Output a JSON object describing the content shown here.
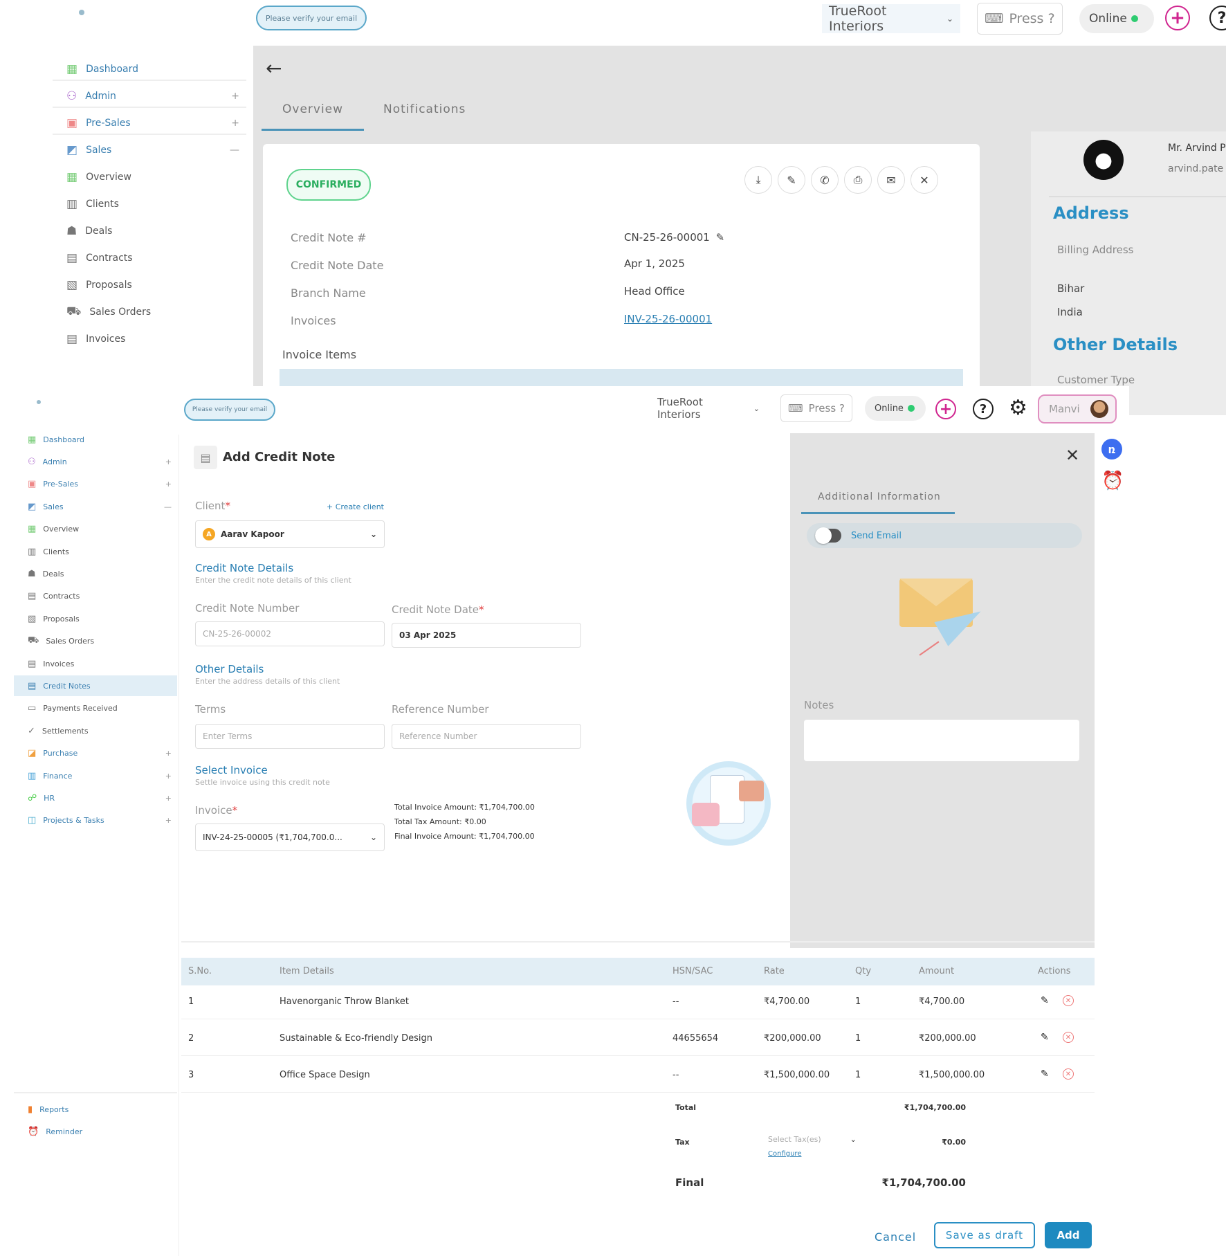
{
  "colors": {
    "accent_blue": "#2a8fc4",
    "brand_pink": "#d0248f",
    "confirmed_green": "#2aae5f",
    "online_green": "#2ecc71",
    "add_button": "#1e8ac0"
  },
  "separator": "&",
  "back_screen": {
    "header": {
      "verify_email": "Please verify your email",
      "company": "TrueRoot Interiors",
      "press_hint": "Press ?",
      "status": "Online"
    },
    "sidebar": [
      {
        "label": "Dashboard",
        "icon": "grid-icon",
        "toggle": ""
      },
      {
        "label": "Admin",
        "icon": "user-admin-icon",
        "toggle": "+"
      },
      {
        "label": "Pre-Sales",
        "icon": "calendar-icon",
        "toggle": "+"
      },
      {
        "label": "Sales",
        "icon": "sales-icon",
        "toggle": "—"
      },
      {
        "label": "Overview",
        "icon": "grid-icon",
        "toggle": ""
      },
      {
        "label": "Clients",
        "icon": "building-icon",
        "toggle": ""
      },
      {
        "label": "Deals",
        "icon": "deal-icon",
        "toggle": ""
      },
      {
        "label": "Contracts",
        "icon": "document-icon",
        "toggle": ""
      },
      {
        "label": "Proposals",
        "icon": "proposal-icon",
        "toggle": ""
      },
      {
        "label": "Sales Orders",
        "icon": "cart-icon",
        "toggle": ""
      },
      {
        "label": "Invoices",
        "icon": "invoice-icon",
        "toggle": ""
      }
    ],
    "tabs": [
      "Overview",
      "Notifications"
    ],
    "status_badge": "CONFIRMED",
    "details": [
      {
        "label": "Credit Note #",
        "value": "CN-25-26-00001"
      },
      {
        "label": "Credit Note Date",
        "value": "Apr 1, 2025"
      },
      {
        "label": "Branch Name",
        "value": "Head Office"
      },
      {
        "label": "Invoices",
        "value": "INV-25-26-00001"
      }
    ],
    "invoice_items_label": "Invoice Items",
    "right_panel": {
      "name": "Mr. Arvind P",
      "email": "arvind.pate",
      "address_heading": "Address",
      "billing_address_label": "Billing Address",
      "address_line1": "Bihar",
      "address_line2": "India",
      "other_details_heading": "Other Details",
      "customer_type_label": "Customer Type"
    }
  },
  "front_screen": {
    "header": {
      "verify_email": "Please verify your email",
      "company": "TrueRoot Interiors",
      "press_hint": "Press ?",
      "status": "Online",
      "user_name": "Manvi"
    },
    "sidebar": [
      {
        "label": "Dashboard",
        "icon": "grid-icon",
        "toggle": ""
      },
      {
        "label": "Admin",
        "icon": "user-admin-icon",
        "toggle": "+"
      },
      {
        "label": "Pre-Sales",
        "icon": "calendar-icon",
        "toggle": "+"
      },
      {
        "label": "Sales",
        "icon": "sales-icon",
        "toggle": "—"
      },
      {
        "label": "Overview",
        "icon": "grid-icon",
        "toggle": ""
      },
      {
        "label": "Clients",
        "icon": "building-icon",
        "toggle": ""
      },
      {
        "label": "Deals",
        "icon": "deal-icon",
        "toggle": ""
      },
      {
        "label": "Contracts",
        "icon": "document-icon",
        "toggle": ""
      },
      {
        "label": "Proposals",
        "icon": "proposal-icon",
        "toggle": ""
      },
      {
        "label": "Sales Orders",
        "icon": "cart-icon",
        "toggle": ""
      },
      {
        "label": "Invoices",
        "icon": "invoice-icon",
        "toggle": ""
      },
      {
        "label": "Credit Notes",
        "icon": "credit-note-icon",
        "toggle": ""
      },
      {
        "label": "Payments Received",
        "icon": "payment-icon",
        "toggle": ""
      },
      {
        "label": "Settlements",
        "icon": "check-icon",
        "toggle": ""
      },
      {
        "label": "Purchase",
        "icon": "purchase-icon",
        "toggle": "+"
      },
      {
        "label": "Finance",
        "icon": "finance-icon",
        "toggle": "+"
      },
      {
        "label": "HR",
        "icon": "hr-icon",
        "toggle": "+"
      },
      {
        "label": "Projects & Tasks",
        "icon": "projects-icon",
        "toggle": "+"
      }
    ],
    "sidebar_bottom": [
      {
        "label": "Reports",
        "icon": "chart-icon"
      },
      {
        "label": "Reminder",
        "icon": "alarm-icon"
      }
    ],
    "form": {
      "title": "Add Credit Note",
      "client_label": "Client",
      "create_client": "+ Create client",
      "client_value": "Aarav Kapoor",
      "client_initial": "A",
      "credit_note_details_title": "Credit Note Details",
      "credit_note_details_sub": "Enter the credit note details of this client",
      "credit_note_number_label": "Credit Note Number",
      "credit_note_number_placeholder": "CN-25-26-00002",
      "credit_note_date_label": "Credit Note Date",
      "credit_note_date_value": "03 Apr 2025",
      "other_details_title": "Other Details",
      "other_details_sub": "Enter the address details of this client",
      "terms_label": "Terms",
      "terms_placeholder": "Enter Terms",
      "reference_label": "Reference Number",
      "reference_placeholder": "Reference Number",
      "select_invoice_title": "Select Invoice",
      "select_invoice_sub": "Settle invoice using this credit note",
      "invoice_label": "Invoice",
      "invoice_value": "INV-24-25-00005 (₹1,704,700.0...",
      "total_invoice_amount": "Total Invoice Amount: ₹1,704,700.00",
      "total_tax_amount": "Total Tax Amount: ₹0.00",
      "final_invoice_amount": "Final Invoice Amount: ₹1,704,700.00"
    },
    "panel": {
      "tab": "Additional Information",
      "send_email": "Send Email",
      "notes_label": "Notes"
    },
    "table": {
      "columns": [
        "S.No.",
        "Item Details",
        "HSN/SAC",
        "Rate",
        "Qty",
        "Amount",
        "Actions"
      ],
      "rows": [
        {
          "sno": "1",
          "item": "Havenorganic Throw Blanket",
          "hsn": "--",
          "rate": "₹4,700.00",
          "qty": "1",
          "amount": "₹4,700.00"
        },
        {
          "sno": "2",
          "item": "Sustainable & Eco-friendly Design",
          "hsn": "44655654",
          "rate": "₹200,000.00",
          "qty": "1",
          "amount": "₹200,000.00"
        },
        {
          "sno": "3",
          "item": "Office Space Design",
          "hsn": "--",
          "rate": "₹1,500,000.00",
          "qty": "1",
          "amount": "₹1,500,000.00"
        }
      ],
      "total_label": "Total",
      "total_value": "₹1,704,700.00",
      "tax_label": "Tax",
      "tax_placeholder": "Select Tax(es)",
      "configure_link": "Configure",
      "tax_value": "₹0.00",
      "final_label": "Final",
      "final_value": "₹1,704,700.00"
    },
    "buttons": {
      "cancel": "Cancel",
      "save_draft": "Save as draft",
      "add": "Add"
    }
  }
}
